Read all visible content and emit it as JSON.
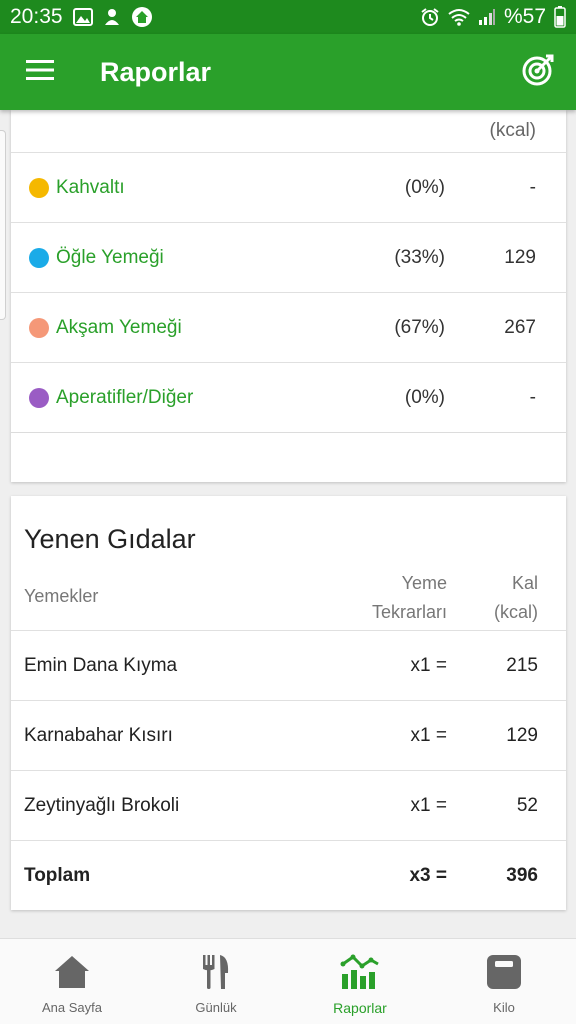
{
  "status_bar": {
    "time": "20:35",
    "battery": "%57"
  },
  "app_bar": {
    "title": "Raporlar"
  },
  "meals_card": {
    "kcal_header": "(kcal)",
    "rows": [
      {
        "name": "Kahvaltı",
        "percent": "(0%)",
        "kcal": "-",
        "color": "#f5b800"
      },
      {
        "name": "Öğle Yemeği",
        "percent": "(33%)",
        "kcal": "129",
        "color": "#1aabe8"
      },
      {
        "name": "Akşam Yemeği",
        "percent": "(67%)",
        "kcal": "267",
        "color": "#f59878"
      },
      {
        "name": "Aperatifler/Diğer",
        "percent": "(0%)",
        "kcal": "-",
        "color": "#9a5cc4"
      }
    ]
  },
  "foods_card": {
    "title": "Yenen Gıdalar",
    "columns": {
      "foods": "Yemekler",
      "repeats_line1": "Yeme",
      "repeats_line2": "Tekrarları",
      "kcal_line1": "Kal",
      "kcal_line2": "(kcal)"
    },
    "rows": [
      {
        "name": "Emin Dana Kıyma",
        "repeat": "x1 =",
        "kcal": "215"
      },
      {
        "name": "Karnabahar Kısırı",
        "repeat": "x1 =",
        "kcal": "129"
      },
      {
        "name": "Zeytinyağlı Brokoli",
        "repeat": "x1 =",
        "kcal": "52"
      }
    ],
    "total": {
      "name": "Toplam",
      "repeat": "x3 =",
      "kcal": "396"
    }
  },
  "bottom_nav": {
    "items": [
      {
        "label": "Ana Sayfa",
        "icon": "home-icon",
        "active": false
      },
      {
        "label": "Günlük",
        "icon": "fork-knife-icon",
        "active": false
      },
      {
        "label": "Raporlar",
        "icon": "chart-icon",
        "active": true
      },
      {
        "label": "Kilo",
        "icon": "scale-icon",
        "active": false
      }
    ]
  },
  "colors": {
    "primary": "#2aa02a",
    "status_bar": "#1e8a1e"
  }
}
